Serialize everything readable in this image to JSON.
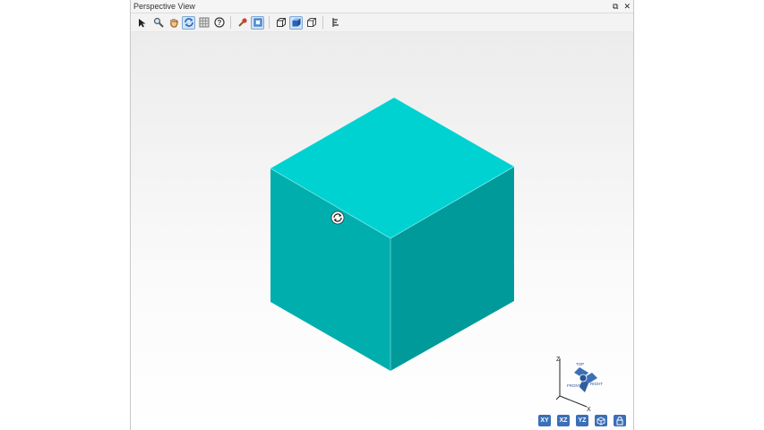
{
  "window": {
    "title": "Perspective View",
    "restore_glyph": "⧉",
    "close_glyph": "✕"
  },
  "toolbar": {
    "buttons": [
      {
        "name": "select-arrow-icon"
      },
      {
        "name": "zoom-icon"
      },
      {
        "name": "pan-hand-icon"
      },
      {
        "name": "rotate-icon",
        "active": true
      },
      {
        "name": "grid-icon"
      },
      {
        "name": "help-icon",
        "label": "?"
      },
      {
        "name": "pick-icon"
      },
      {
        "name": "fit-icon",
        "active": true
      },
      {
        "name": "wireframe-cube-icon"
      },
      {
        "name": "shaded-cube-icon",
        "active": true
      },
      {
        "name": "hidden-line-cube-icon"
      },
      {
        "name": "layout-icon"
      }
    ]
  },
  "triad": {
    "z_label": "Z",
    "x_label": "X",
    "top_label": "TOP",
    "front_label": "FRONT",
    "right_label": "RIGHT"
  },
  "view_buttons": {
    "xy": "XY",
    "xz": "XZ",
    "yz": "YZ"
  },
  "colors": {
    "cube_top": "#00d2d2",
    "cube_left": "#00aeae",
    "cube_right": "#009a9a",
    "accent": "#3b6fb6"
  }
}
